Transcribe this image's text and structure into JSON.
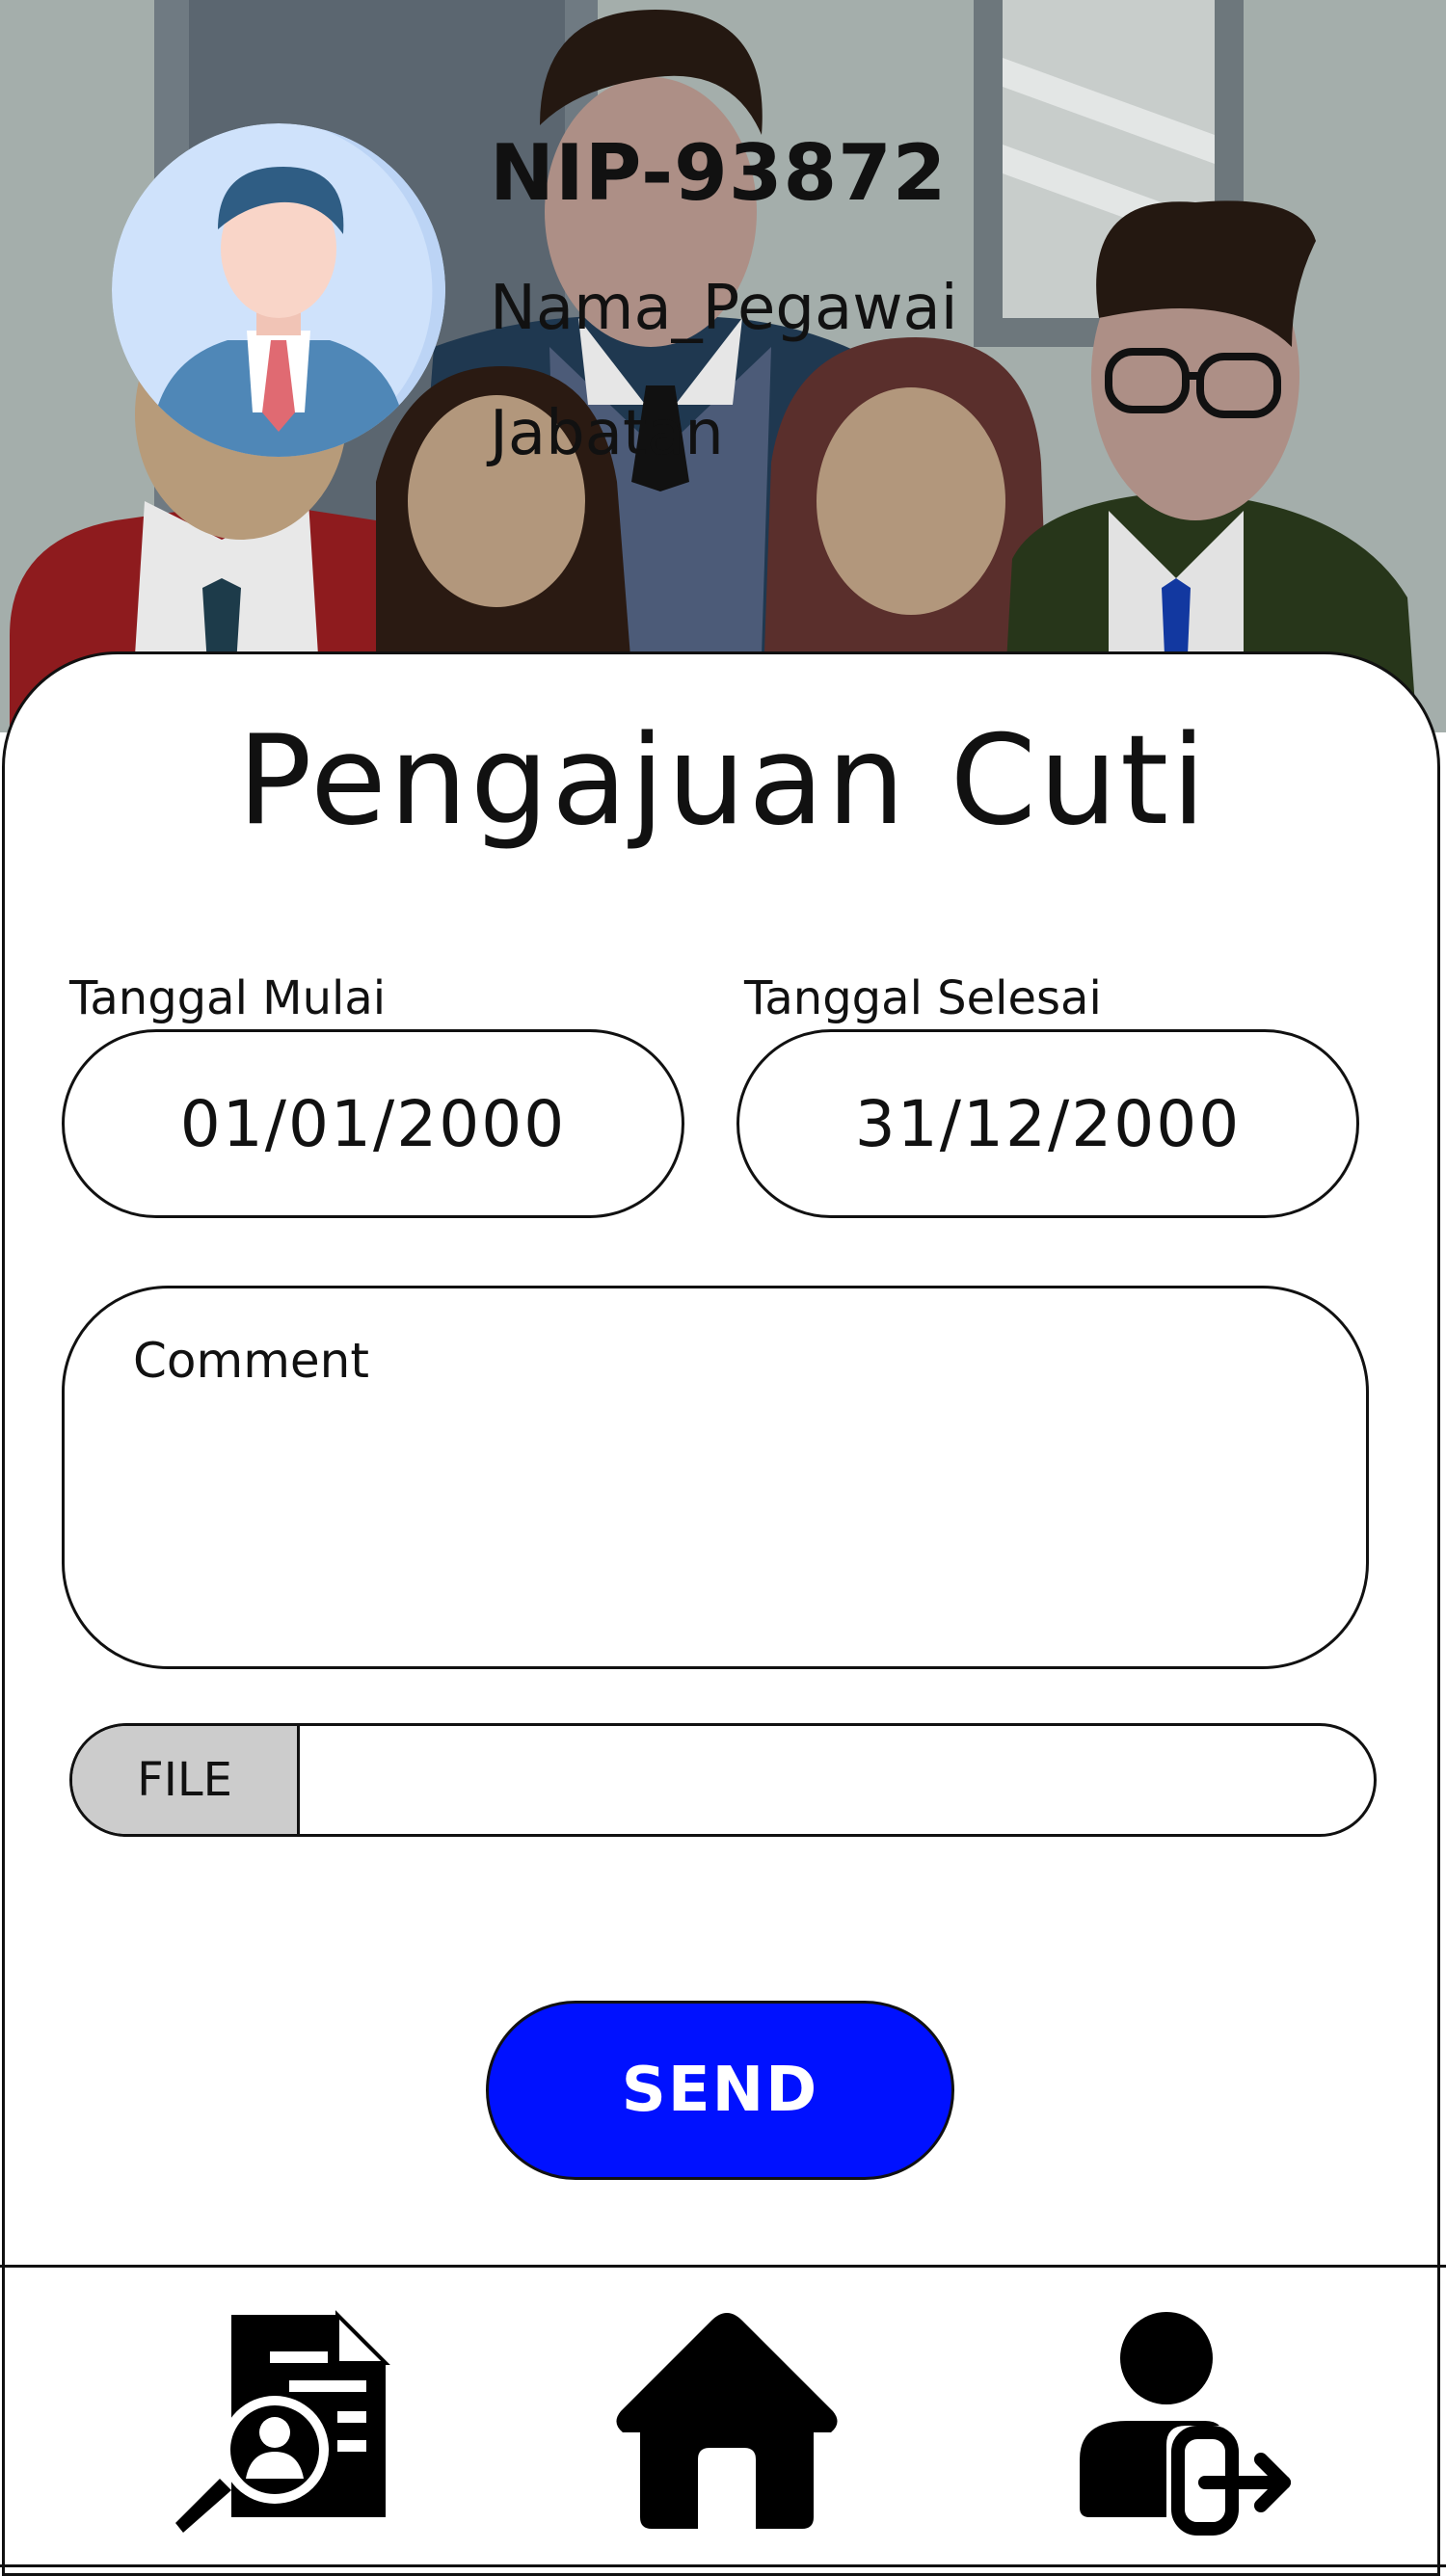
{
  "profile": {
    "nip": "NIP-93872",
    "name": "Nama_Pegawai",
    "position": "Jabatan",
    "avatar_icon": "user-avatar-icon"
  },
  "form": {
    "title": "Pengajuan Cuti",
    "start_date_label": "Tanggal Mulai",
    "start_date_value": "01/01/2000",
    "end_date_label": "Tanggal Selesai",
    "end_date_value": "31/12/2000",
    "comment_placeholder": "Comment",
    "file_button_label": "FILE",
    "send_label": "SEND"
  },
  "nav": {
    "items": [
      {
        "icon": "document-search-icon"
      },
      {
        "icon": "home-icon"
      },
      {
        "icon": "user-logout-icon"
      }
    ]
  },
  "colors": {
    "send_button": "#0011ff",
    "file_button": "#cccccc",
    "avatar_bg": "#cfe2fb"
  }
}
